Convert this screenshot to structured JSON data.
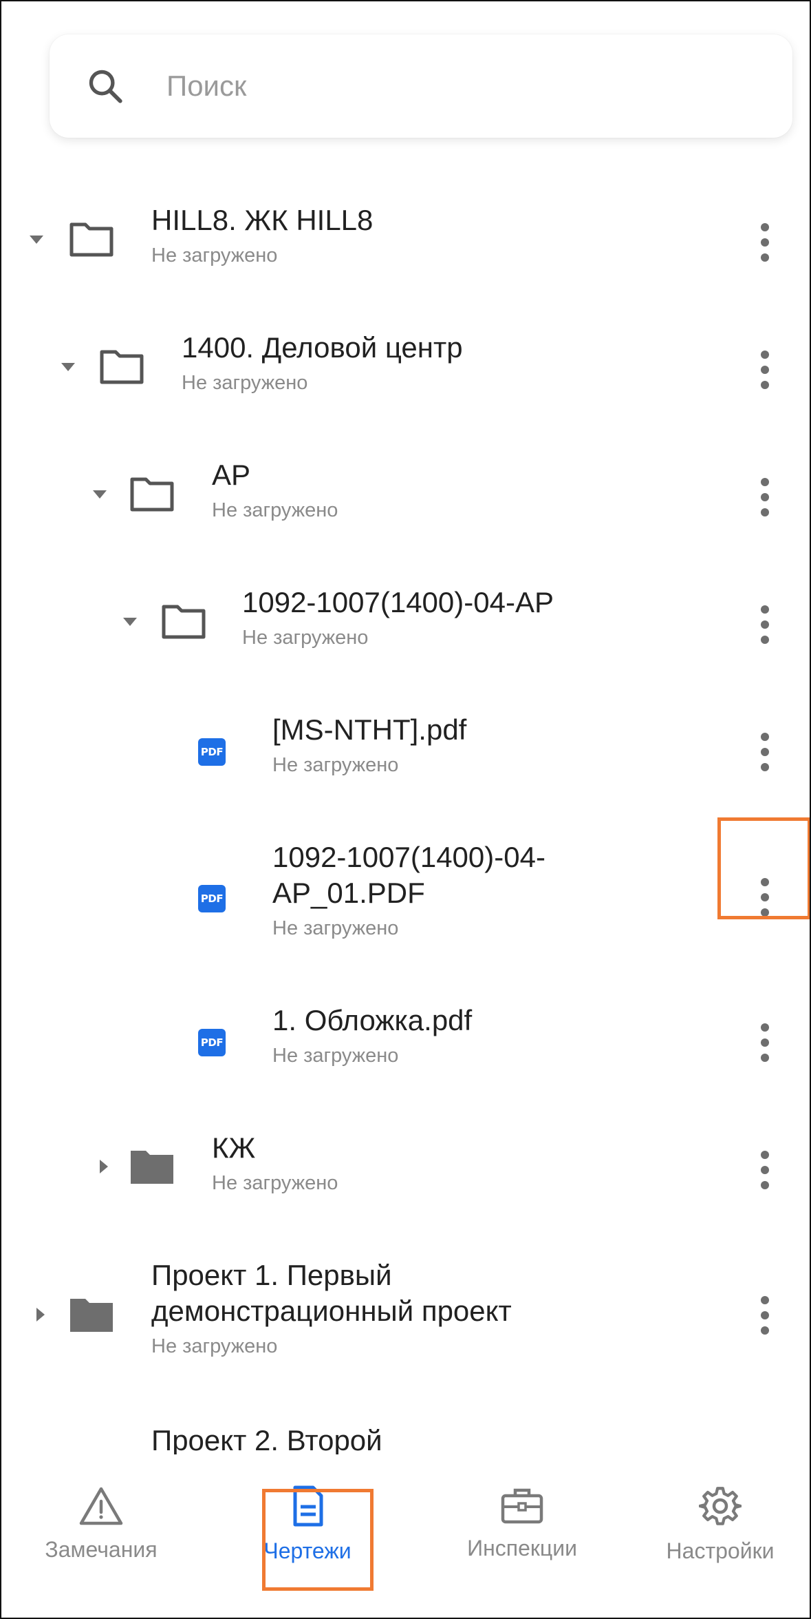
{
  "search": {
    "placeholder": "Поиск"
  },
  "tree": [
    {
      "title": "HILL8. ЖК HILL8",
      "status": "Не загружено"
    },
    {
      "title": "1400. Деловой центр",
      "status": "Не загружено"
    },
    {
      "title": "АР",
      "status": "Не загружено"
    },
    {
      "title": "1092-1007(1400)-04-АР",
      "status": "Не загружено"
    },
    {
      "title": "[MS-NTHT].pdf",
      "status": "Не загружено",
      "badge": "PDF"
    },
    {
      "title_line1": "1092-1007(1400)-04-",
      "title_line2": "AP_01.PDF",
      "status": "Не загружено",
      "badge": "PDF"
    },
    {
      "title": "1. Обложка.pdf",
      "status": "Не загружено",
      "badge": "PDF"
    },
    {
      "title": "КЖ",
      "status": "Не загружено"
    },
    {
      "title_line1": "Проект 1. Первый",
      "title_line2": "демонстрационный проект",
      "status": "Не загружено"
    },
    {
      "title": "Проект 2. Второй"
    }
  ],
  "nav": [
    {
      "label": "Замечания",
      "icon": "warning-icon"
    },
    {
      "label": "Чертежи",
      "icon": "document-icon",
      "active": true
    },
    {
      "label": "Инспекции",
      "icon": "toolbox-icon"
    },
    {
      "label": "Настройки",
      "icon": "gear-icon"
    }
  ],
  "colors": {
    "accent": "#1e6fe6",
    "highlight": "#f07a32",
    "muted": "#8a8a8a"
  }
}
